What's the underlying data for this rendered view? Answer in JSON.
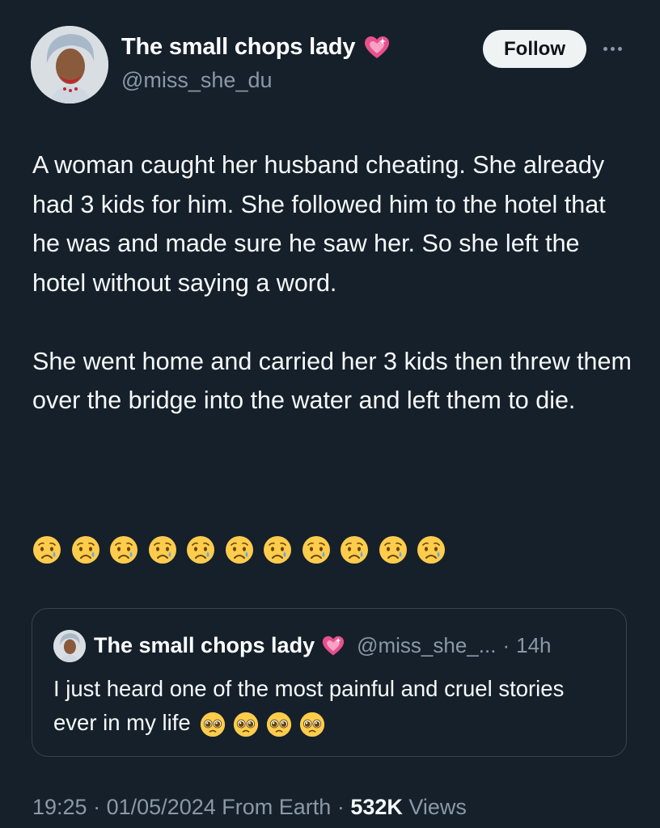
{
  "author": {
    "display_name": "The small chops lady",
    "handle": "@miss_she_du",
    "badge_icon": "sparkling-heart-icon"
  },
  "actions": {
    "follow_label": "Follow",
    "more_icon": "more-horizontal-icon"
  },
  "tweet": {
    "paragraphs": [
      "A woman caught her husband cheating. She already had 3 kids for him. She followed him to the hotel that he was and made sure he saw her. So she left the hotel without saying a word.",
      "She went home and carried her 3 kids then threw them over the bridge into the water and left them to die."
    ],
    "emoji_icon": "sad-but-relieved-face-icon",
    "emoji_count": 11
  },
  "quoted_tweet": {
    "display_name": "The small chops lady",
    "handle": "@miss_she_...",
    "separator": "·",
    "time": "14h",
    "text": "I just heard one of the most painful and cruel stories ever in my life",
    "emoji_icon": "pleading-face-icon",
    "emoji_count": 4
  },
  "meta": {
    "time": "19:25",
    "sep1": "·",
    "date": "01/05/2024",
    "source": "From Earth",
    "sep2": "·",
    "views_count": "532K",
    "views_label": "Views"
  },
  "colors": {
    "background": "#15202b",
    "text": "#f7f9f9",
    "muted": "#8b98a5",
    "border": "#38444d",
    "heart": "#e8508c",
    "emoji_yellow": "#ffcc4d",
    "tear": "#5dadec"
  }
}
